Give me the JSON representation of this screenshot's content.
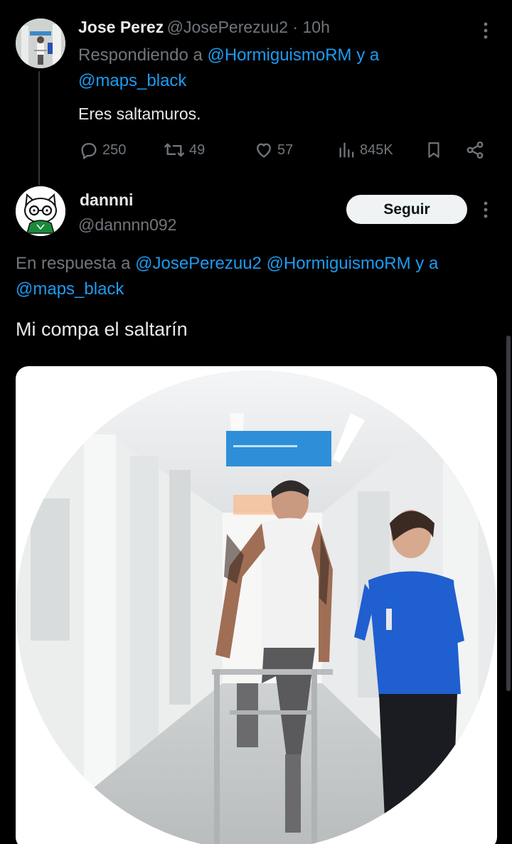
{
  "reply1": {
    "name": "Jose Perez",
    "handle_time": "@JosePerezuu2 · 10h",
    "replying_prefix": "Respondiendo a ",
    "replying_user1": "@HormiguismoRM",
    "replying_join": " y a",
    "replying_user2": "@maps_black",
    "text": "Eres saltamuros.",
    "stats": {
      "replies": "250",
      "reposts": "49",
      "likes": "57",
      "views": "845K"
    },
    "icons": [
      "reply-icon",
      "repost-icon",
      "like-icon",
      "views-icon",
      "bookmark-icon",
      "share-icon"
    ]
  },
  "reply2": {
    "name": "dannni",
    "handle": "@dannnn092",
    "follow_label": "Seguir",
    "in_reply_prefix": "En respuesta a ",
    "in_reply_user1": "@JosePerezuu2",
    "in_reply_user2": "@HormiguismoRM",
    "in_reply_join": " y a",
    "in_reply_user3": "@maps_black",
    "text": "Mi compa el saltarín"
  },
  "colors": {
    "background": "#000000",
    "link": "#1d9bf0",
    "secondary_text": "#71767b",
    "primary_text": "#e7e9ea",
    "follow_button_bg": "#eff3f4"
  }
}
